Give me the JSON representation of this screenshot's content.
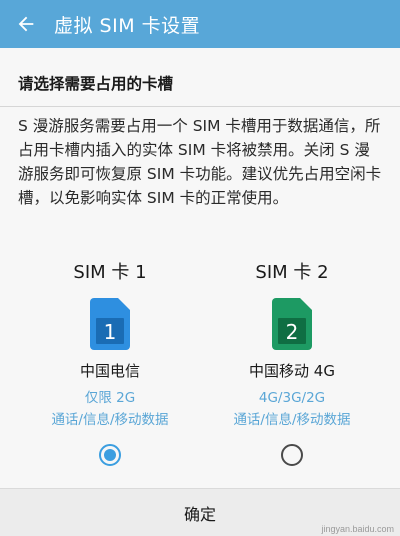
{
  "colors": {
    "appbar": "#58a7d8",
    "accent": "#3b9ee0",
    "link_text": "#5aa6d6",
    "sim1": "#2e8fe0",
    "sim2": "#1d9a63"
  },
  "header": {
    "back_icon": "arrow-left-icon",
    "title": "虚拟 SIM 卡设置"
  },
  "section_heading": "请选择需要占用的卡槽",
  "description": "S 漫游服务需要占用一个 SIM 卡槽用于数据通信，所占用卡槽内插入的实体 SIM 卡将被禁用。关闭 S 漫游服务即可恢复原 SIM 卡功能。建议优先占用空闲卡槽，以免影响实体 SIM 卡的正常使用。",
  "sims": [
    {
      "name": "SIM 卡 1",
      "number": "1",
      "icon": "sim-card-icon",
      "carrier": "中国电信",
      "network": "仅限 2G",
      "services": "通话/信息/移动数据",
      "selected": true
    },
    {
      "name": "SIM 卡 2",
      "number": "2",
      "icon": "sim-card-icon",
      "carrier": "中国移动 4G",
      "network": "4G/3G/2G",
      "services": "通话/信息/移动数据",
      "selected": false
    }
  ],
  "footer": {
    "confirm_label": "确定"
  },
  "watermark": "jingyan.baidu.com"
}
